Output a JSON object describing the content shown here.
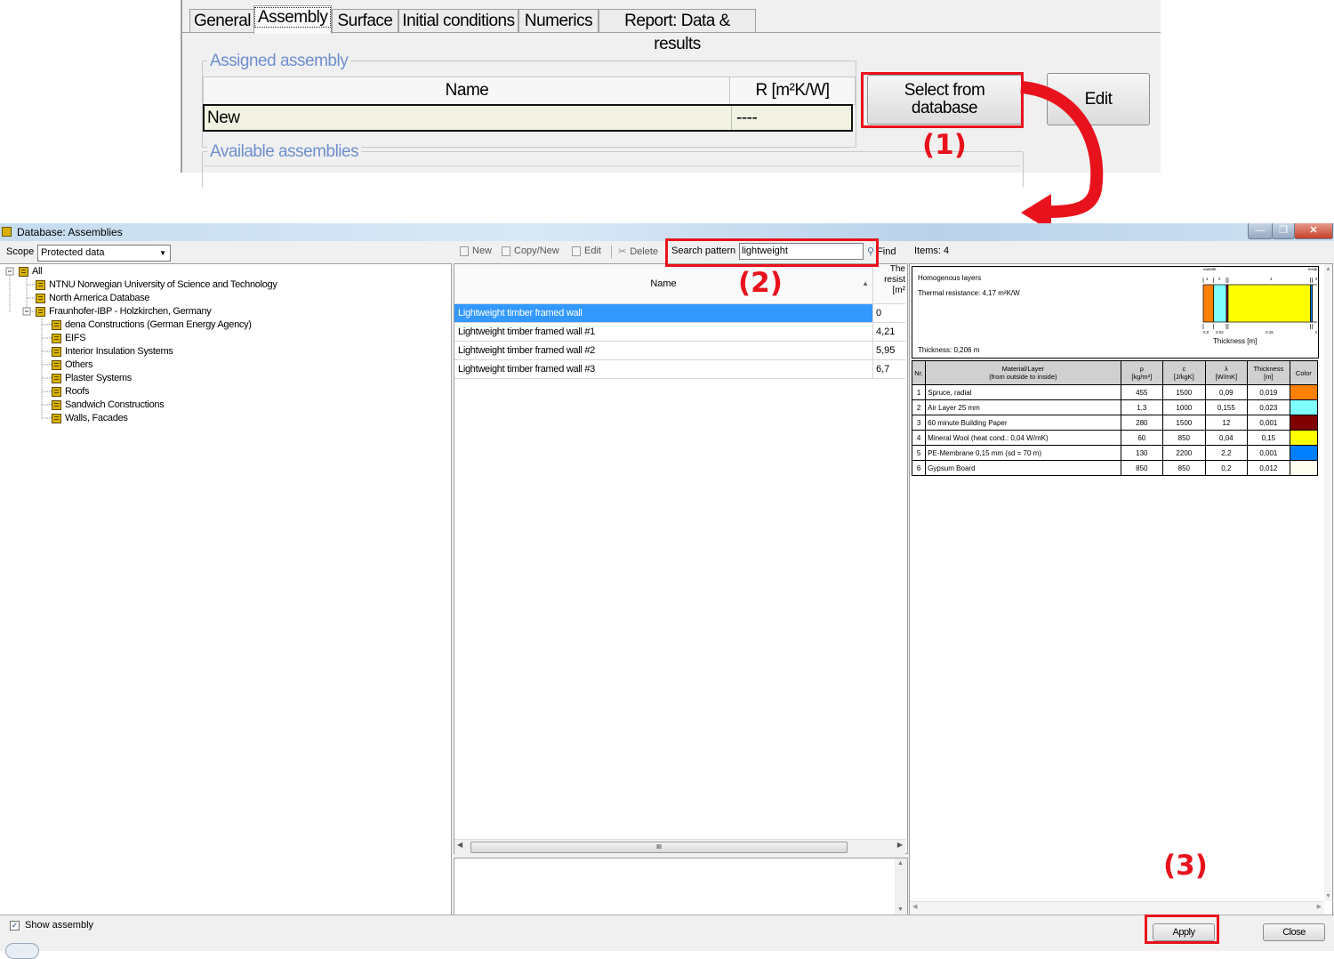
{
  "top_panel": {
    "tabs": [
      "General",
      "Assembly",
      "Surface",
      "Initial conditions",
      "Numerics",
      "Report: Data & results"
    ],
    "assigned_group_title": "Assigned assembly",
    "col_name": "Name",
    "col_r": "R [m²K/W]",
    "assigned_name": "New",
    "assigned_r": "----",
    "select_button": "Select from database",
    "edit_button": "Edit",
    "available_group_title": "Available assemblies"
  },
  "annotations": {
    "step1": "(1)",
    "step2": "(2)",
    "step3": "(3)",
    "accent_color": "#e8121d"
  },
  "window": {
    "title": "Database: Assemblies",
    "caption_buttons": [
      "minimize-icon",
      "maximize-icon",
      "close-icon"
    ],
    "scope_label": "Scope",
    "scope_value": "Protected data",
    "tree": {
      "root": "All",
      "items": [
        "NTNU Norwegian University of Science and Technology",
        "North America Database",
        "Fraunhofer-IBP - Holzkirchen, Germany",
        "dena Constructions (German Energy Agency)",
        "EIFS",
        "Interior Insulation Systems",
        "Others",
        "Plaster Systems",
        "Roofs",
        "Sandwich Constructions",
        "Walls, Facades"
      ]
    },
    "toolbar": {
      "new": "New",
      "copy_new": "Copy/New",
      "edit": "Edit",
      "delete": "Delete",
      "search_label": "Search pattern",
      "search_value": "lightweight",
      "find": "Find",
      "items": "Items: 4"
    },
    "list": {
      "col_name": "Name",
      "col_r_line1": "The",
      "col_r_line2": "resist",
      "col_r_line3": "[m²",
      "rows": [
        {
          "name": "Lightweight timber framed wall",
          "value": "0",
          "selected": true
        },
        {
          "name": "Lightweight timber framed wall #1",
          "value": "4,21",
          "selected": false
        },
        {
          "name": "Lightweight timber framed wall #2",
          "value": "5,95",
          "selected": false
        },
        {
          "name": "Lightweight timber framed wall #3",
          "value": "6,7",
          "selected": false
        }
      ],
      "hscroll_grip": "III"
    },
    "preview": {
      "line1": "Homogenous layers",
      "line2": "Thermal resistance: 4,17 m²K/W",
      "line3": "Thickness: 0,206 m",
      "axis_title": "Thickness [m]",
      "outside": "outside",
      "inside": "inside",
      "layer_nums": [
        "1",
        "2",
        "4",
        "6"
      ],
      "thickness_ticks": [
        "0.0",
        "0.02",
        "0.15",
        "0."
      ],
      "table_headers": {
        "nr": "Nr.",
        "material_l1": "Material/Layer",
        "material_l2": "(from outside to inside)",
        "rho_l1": "ρ",
        "rho_l2": "[kg/m³]",
        "c_l1": "c",
        "c_l2": "[J/kgK]",
        "lambda_l1": "λ",
        "lambda_l2": "[W/mK]",
        "thick_l1": "Thickness",
        "thick_l2": "[m]",
        "color": "Color"
      },
      "layers": [
        {
          "nr": "1",
          "name": "Spruce, radial",
          "rho": "455",
          "c": "1500",
          "lambda": "0,09",
          "thickness": "0,019",
          "color": "#ff8000"
        },
        {
          "nr": "2",
          "name": "Air Layer 25 mm",
          "rho": "1,3",
          "c": "1000",
          "lambda": "0,155",
          "thickness": "0,023",
          "color": "#80ffff"
        },
        {
          "nr": "3",
          "name": "60 minute Building Paper",
          "rho": "280",
          "c": "1500",
          "lambda": "12",
          "thickness": "0,001",
          "color": "#800000"
        },
        {
          "nr": "4",
          "name": "Mineral Wool (heat cond.: 0,04 W/mK)",
          "rho": "60",
          "c": "850",
          "lambda": "0,04",
          "thickness": "0,15",
          "color": "#ffff00"
        },
        {
          "nr": "5",
          "name": "PE-Membrane 0,15 mm (sd = 70 m)",
          "rho": "130",
          "c": "2200",
          "lambda": "2,2",
          "thickness": "0,001",
          "color": "#0080ff"
        },
        {
          "nr": "6",
          "name": "Gypsum Board",
          "rho": "850",
          "c": "850",
          "lambda": "0,2",
          "thickness": "0,012",
          "color": "#fffff0"
        }
      ]
    },
    "show_assembly_label": "Show assembly",
    "apply_button": "Apply",
    "close_button": "Close"
  }
}
